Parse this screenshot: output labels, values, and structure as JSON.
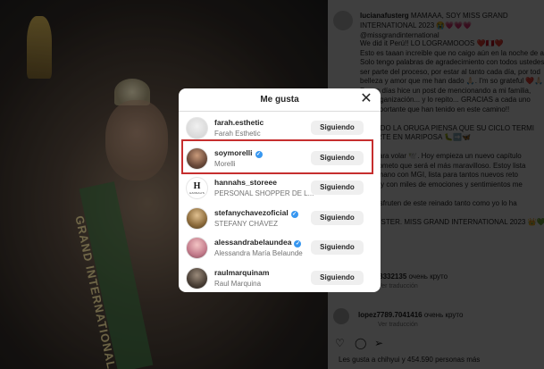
{
  "post": {
    "username": "lucianafusterg",
    "header_text": "MAMAAA, SOY MISS GRAND INTERNATIONAL 2023 😭💗💗💗 @missgrandinternational",
    "caption_lines": [
      "We did it Perú!! LO LOGRAMOOOS ❤️🇵🇪❤️",
      "Esto es taaan increible que no caigo aún en la noche de ay",
      "Solo tengo palabras de agradecimiento con todos ustedes",
      "ser parte del proceso, por estar al tanto cada día, por tod",
      "belleza y amor que me han dado 🙏🏻. I'm so grateful ❤️🙏🏻",
      "Pocos días hice un post de mencionando a mi familia,",
      "a la organización... y lo repito... GRACIAS a cada uno",
      "tan importante que han tenido en este camino!!",
      "",
      "CUANDO LA ORUGA PIENSA QUE SU CICLO TERMI",
      "NVIERTE EN MARIPOSA 🐛➡️🦋",
      "",
      "lista para volar 🕊️. Hoy empieza un nuevo capítulo",
      "me prometo que será el más maravilloso. Estoy lista",
      "de la mano con MGI, lista para tantos nuevos reto",
      "a feliz y con miles de emociones y sentimientos me",
      "",
      "que disfruten de este reinado tanto como yo lo ha",
      "",
      "NA FUSTER. MISS GRAND INTERNATIONAL 2023 👑💚"
    ],
    "comments": [
      {
        "user": "4oso98332135",
        "text": "очень круто",
        "meta": "Ver traducción"
      },
      {
        "user": "lopez7789.7041416",
        "text": "очень круто",
        "meta": "Ver traducción"
      }
    ],
    "likes_text": "Les gusta a chihyui y 454.590 personas más",
    "sash_text": "GRAND INTERNATIONAL"
  },
  "modal": {
    "title": "Me gusta",
    "close_glyph": "✕",
    "verified_glyph": "✓",
    "users": [
      {
        "username": "farah.esthetic",
        "full_name": "Farah Esthetic",
        "verified": false,
        "button": "Siguiendo"
      },
      {
        "username": "soymorelli",
        "full_name": "Morelli",
        "verified": true,
        "button": "Siguiendo"
      },
      {
        "username": "hannahs_storeee",
        "full_name": "PERSONAL SHOPPER DE L...",
        "verified": false,
        "button": "Siguiendo",
        "logo_text": "H",
        "logo_sub": "HANNAH'S"
      },
      {
        "username": "stefanychavezoficial",
        "full_name": "STEFANY CHÁVEZ",
        "verified": true,
        "button": "Siguiendo"
      },
      {
        "username": "alessandrabelaundea",
        "full_name": "Alessandra María Belaunde",
        "verified": true,
        "button": "Siguiendo"
      },
      {
        "username": "raulmarquinam",
        "full_name": "Raul Marquina",
        "verified": false,
        "button": "Siguiendo"
      }
    ]
  },
  "colors": {
    "highlight": "#c62e2e",
    "verified": "#3897f0",
    "button_bg": "#efefef"
  },
  "icons": [
    "heart-icon",
    "comment-icon",
    "share-icon",
    "close-icon",
    "verified-icon"
  ]
}
